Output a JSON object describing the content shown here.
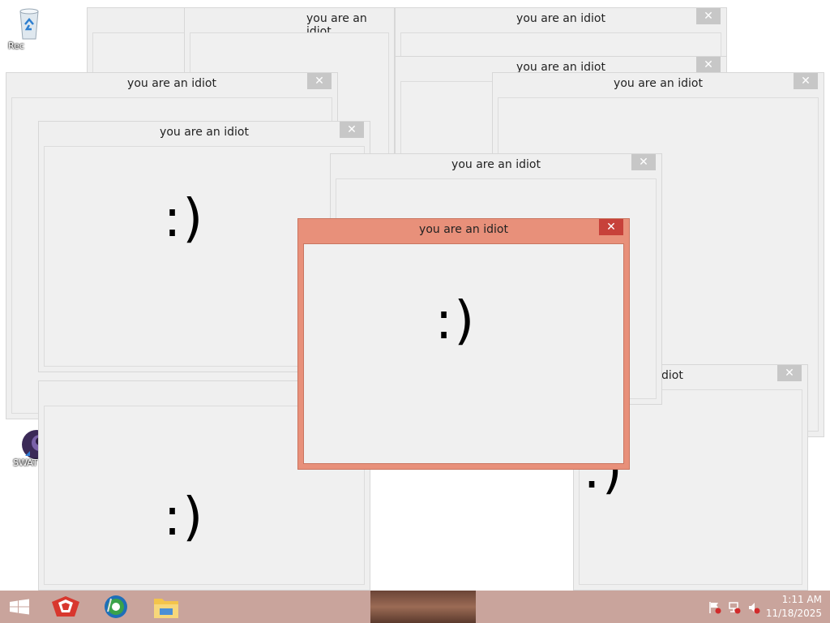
{
  "desktop": {
    "icons": [
      {
        "label": "Rec"
      },
      {
        "label": "SWAT"
      }
    ]
  },
  "windows": [
    {
      "title": "you are an idiot",
      "close": "✕",
      "smile": ":)"
    },
    {
      "title": "you are an idiot",
      "close": "✕",
      "smile": ":)"
    },
    {
      "title": "you are an idiot",
      "close": "✕",
      "smile": ":)"
    },
    {
      "title": "you are an idiot",
      "close": "✕",
      "smile": ":)"
    },
    {
      "title": "you are an idiot",
      "close": "✕",
      "smile": ":)"
    },
    {
      "title": "you are an idiot",
      "close": "✕",
      "smile": ":)"
    },
    {
      "title": "you are an idiot",
      "close": "✕",
      "smile": ":)"
    },
    {
      "title": "you are an idiot",
      "close": "✕",
      "smile": ":)"
    },
    {
      "title": "diot",
      "close": "✕",
      "smile": ":)"
    },
    {
      "title": "you are an idiot",
      "close": "✕",
      "smile": ":)"
    }
  ],
  "taskbar": {
    "start_icon": "windows-start-icon",
    "pinned": [
      "game-app-icon",
      "browser-globe-icon",
      "file-explorer-icon"
    ],
    "tray_icons": [
      "action-center-flag-icon",
      "network-icon",
      "volume-muted-icon"
    ],
    "time": "1:11 AM",
    "date": "11/18/2025"
  },
  "colors": {
    "active_frame": "#e8907a",
    "active_close": "#c7413a",
    "inactive_frame": "#efefef",
    "taskbar": "#c9a49c"
  }
}
